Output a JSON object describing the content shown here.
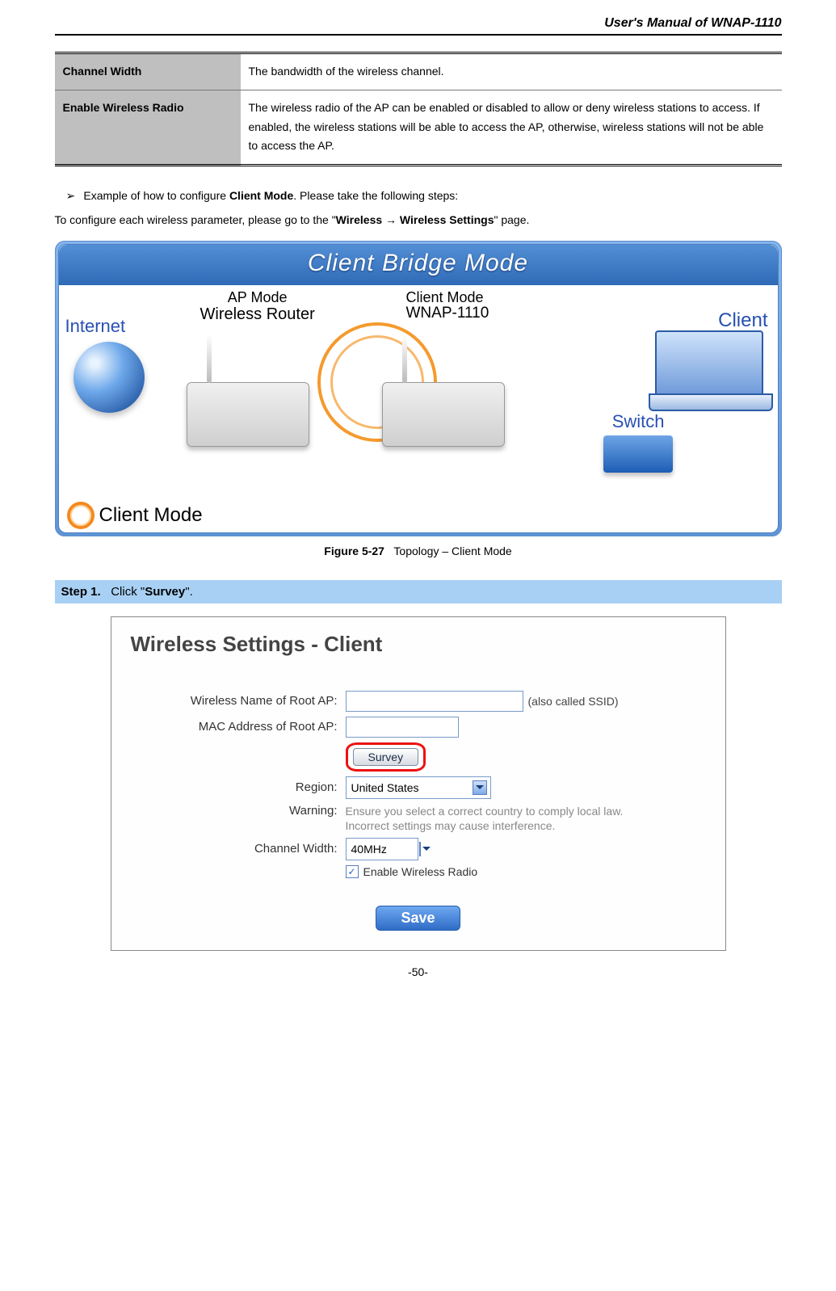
{
  "header": {
    "title": "User's Manual of WNAP-1110"
  },
  "param_table": [
    {
      "name": "Channel Width",
      "desc": "The bandwidth of the wireless channel."
    },
    {
      "name": "Enable Wireless Radio",
      "desc": "The wireless radio of the AP can be enabled or disabled to allow or deny wireless stations to access. If enabled, the wireless stations will be able to access the AP, otherwise, wireless stations will not be able to access the AP."
    }
  ],
  "example": {
    "bullet_prefix": "Example of how to configure ",
    "bullet_bold": "Client Mode",
    "bullet_suffix": ". Please take the following steps:",
    "config_prefix": "To configure each wireless parameter, please go to the \"",
    "config_bold": "Wireless → Wireless Settings",
    "config_suffix": "\" page."
  },
  "diagram": {
    "title": "Client Bridge Mode",
    "ap_mode": "AP Mode",
    "ap_sub": "Wireless Router",
    "client_mode": "Client Mode",
    "client_sub": "WNAP-1110",
    "internet": "Internet",
    "client": "Client",
    "switch": "Switch",
    "footer": "Client Mode"
  },
  "caption": {
    "bold": "Figure 5-27",
    "text": "Topology – Client Mode"
  },
  "step": {
    "label": "Step 1.",
    "text_prefix": "Click \"",
    "text_bold": "Survey",
    "text_suffix": "\"."
  },
  "settings": {
    "title": "Wireless Settings - Client",
    "ssid_label": "Wireless Name of Root AP:",
    "ssid_value": "",
    "ssid_note": "(also called SSID)",
    "mac_label": "MAC Address of Root AP:",
    "mac_value": "",
    "survey_btn": "Survey",
    "region_label": "Region:",
    "region_value": "United States",
    "warning_label": "Warning:",
    "warning_text": "Ensure you select a correct country to comply local law. Incorrect settings may cause interference.",
    "ch_label": "Channel Width:",
    "ch_value": "40MHz",
    "enable_label": "Enable Wireless Radio",
    "save_btn": "Save"
  },
  "page_number": "-50-"
}
